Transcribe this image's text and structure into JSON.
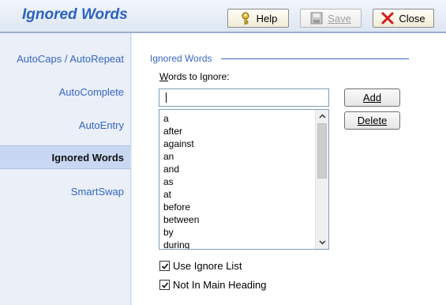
{
  "header": {
    "title": "Ignored Words",
    "help_label": "Help",
    "save_label": "Save",
    "close_label": "Close"
  },
  "sidebar": {
    "items": [
      {
        "label": "AutoCaps / AutoRepeat"
      },
      {
        "label": "AutoComplete"
      },
      {
        "label": "AutoEntry"
      },
      {
        "label": "Ignored Words"
      },
      {
        "label": "SmartSwap"
      }
    ],
    "active": "Ignored Words"
  },
  "main": {
    "group_title": "Ignored Words",
    "field_label": "Words to Ignore:",
    "input_value": "",
    "add_label": "Add",
    "delete_label": "Delete",
    "words": [
      "a",
      "after",
      "against",
      "an",
      "and",
      "as",
      "at",
      "before",
      "between",
      "by",
      "during"
    ],
    "use_ignore_list": {
      "label": "Use Ignore List",
      "checked": true
    },
    "not_in_main_heading": {
      "label": "Not In Main Heading",
      "checked": true
    }
  },
  "icons": {
    "help": "key-icon",
    "save": "floppy-icon",
    "close": "red-x-icon"
  },
  "colors": {
    "accent": "#2a62c2",
    "link": "#3566c6",
    "active_bg": "#c8d8f3"
  }
}
